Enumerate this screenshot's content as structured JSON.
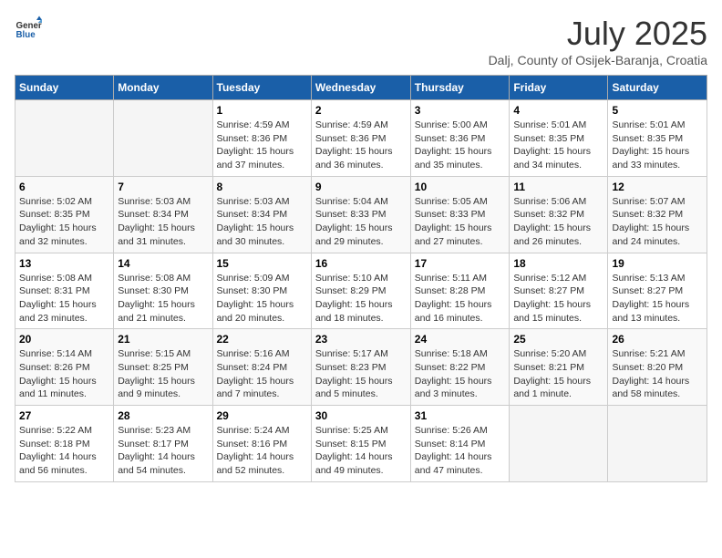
{
  "logo": {
    "line1": "General",
    "line2": "Blue"
  },
  "title": "July 2025",
  "subtitle": "Dalj, County of Osijek-Baranja, Croatia",
  "headers": [
    "Sunday",
    "Monday",
    "Tuesday",
    "Wednesday",
    "Thursday",
    "Friday",
    "Saturday"
  ],
  "weeks": [
    [
      {
        "day": "",
        "info": ""
      },
      {
        "day": "",
        "info": ""
      },
      {
        "day": "1",
        "info": "Sunrise: 4:59 AM\nSunset: 8:36 PM\nDaylight: 15 hours and 37 minutes."
      },
      {
        "day": "2",
        "info": "Sunrise: 4:59 AM\nSunset: 8:36 PM\nDaylight: 15 hours and 36 minutes."
      },
      {
        "day": "3",
        "info": "Sunrise: 5:00 AM\nSunset: 8:36 PM\nDaylight: 15 hours and 35 minutes."
      },
      {
        "day": "4",
        "info": "Sunrise: 5:01 AM\nSunset: 8:35 PM\nDaylight: 15 hours and 34 minutes."
      },
      {
        "day": "5",
        "info": "Sunrise: 5:01 AM\nSunset: 8:35 PM\nDaylight: 15 hours and 33 minutes."
      }
    ],
    [
      {
        "day": "6",
        "info": "Sunrise: 5:02 AM\nSunset: 8:35 PM\nDaylight: 15 hours and 32 minutes."
      },
      {
        "day": "7",
        "info": "Sunrise: 5:03 AM\nSunset: 8:34 PM\nDaylight: 15 hours and 31 minutes."
      },
      {
        "day": "8",
        "info": "Sunrise: 5:03 AM\nSunset: 8:34 PM\nDaylight: 15 hours and 30 minutes."
      },
      {
        "day": "9",
        "info": "Sunrise: 5:04 AM\nSunset: 8:33 PM\nDaylight: 15 hours and 29 minutes."
      },
      {
        "day": "10",
        "info": "Sunrise: 5:05 AM\nSunset: 8:33 PM\nDaylight: 15 hours and 27 minutes."
      },
      {
        "day": "11",
        "info": "Sunrise: 5:06 AM\nSunset: 8:32 PM\nDaylight: 15 hours and 26 minutes."
      },
      {
        "day": "12",
        "info": "Sunrise: 5:07 AM\nSunset: 8:32 PM\nDaylight: 15 hours and 24 minutes."
      }
    ],
    [
      {
        "day": "13",
        "info": "Sunrise: 5:08 AM\nSunset: 8:31 PM\nDaylight: 15 hours and 23 minutes."
      },
      {
        "day": "14",
        "info": "Sunrise: 5:08 AM\nSunset: 8:30 PM\nDaylight: 15 hours and 21 minutes."
      },
      {
        "day": "15",
        "info": "Sunrise: 5:09 AM\nSunset: 8:30 PM\nDaylight: 15 hours and 20 minutes."
      },
      {
        "day": "16",
        "info": "Sunrise: 5:10 AM\nSunset: 8:29 PM\nDaylight: 15 hours and 18 minutes."
      },
      {
        "day": "17",
        "info": "Sunrise: 5:11 AM\nSunset: 8:28 PM\nDaylight: 15 hours and 16 minutes."
      },
      {
        "day": "18",
        "info": "Sunrise: 5:12 AM\nSunset: 8:27 PM\nDaylight: 15 hours and 15 minutes."
      },
      {
        "day": "19",
        "info": "Sunrise: 5:13 AM\nSunset: 8:27 PM\nDaylight: 15 hours and 13 minutes."
      }
    ],
    [
      {
        "day": "20",
        "info": "Sunrise: 5:14 AM\nSunset: 8:26 PM\nDaylight: 15 hours and 11 minutes."
      },
      {
        "day": "21",
        "info": "Sunrise: 5:15 AM\nSunset: 8:25 PM\nDaylight: 15 hours and 9 minutes."
      },
      {
        "day": "22",
        "info": "Sunrise: 5:16 AM\nSunset: 8:24 PM\nDaylight: 15 hours and 7 minutes."
      },
      {
        "day": "23",
        "info": "Sunrise: 5:17 AM\nSunset: 8:23 PM\nDaylight: 15 hours and 5 minutes."
      },
      {
        "day": "24",
        "info": "Sunrise: 5:18 AM\nSunset: 8:22 PM\nDaylight: 15 hours and 3 minutes."
      },
      {
        "day": "25",
        "info": "Sunrise: 5:20 AM\nSunset: 8:21 PM\nDaylight: 15 hours and 1 minute."
      },
      {
        "day": "26",
        "info": "Sunrise: 5:21 AM\nSunset: 8:20 PM\nDaylight: 14 hours and 58 minutes."
      }
    ],
    [
      {
        "day": "27",
        "info": "Sunrise: 5:22 AM\nSunset: 8:18 PM\nDaylight: 14 hours and 56 minutes."
      },
      {
        "day": "28",
        "info": "Sunrise: 5:23 AM\nSunset: 8:17 PM\nDaylight: 14 hours and 54 minutes."
      },
      {
        "day": "29",
        "info": "Sunrise: 5:24 AM\nSunset: 8:16 PM\nDaylight: 14 hours and 52 minutes."
      },
      {
        "day": "30",
        "info": "Sunrise: 5:25 AM\nSunset: 8:15 PM\nDaylight: 14 hours and 49 minutes."
      },
      {
        "day": "31",
        "info": "Sunrise: 5:26 AM\nSunset: 8:14 PM\nDaylight: 14 hours and 47 minutes."
      },
      {
        "day": "",
        "info": ""
      },
      {
        "day": "",
        "info": ""
      }
    ]
  ]
}
